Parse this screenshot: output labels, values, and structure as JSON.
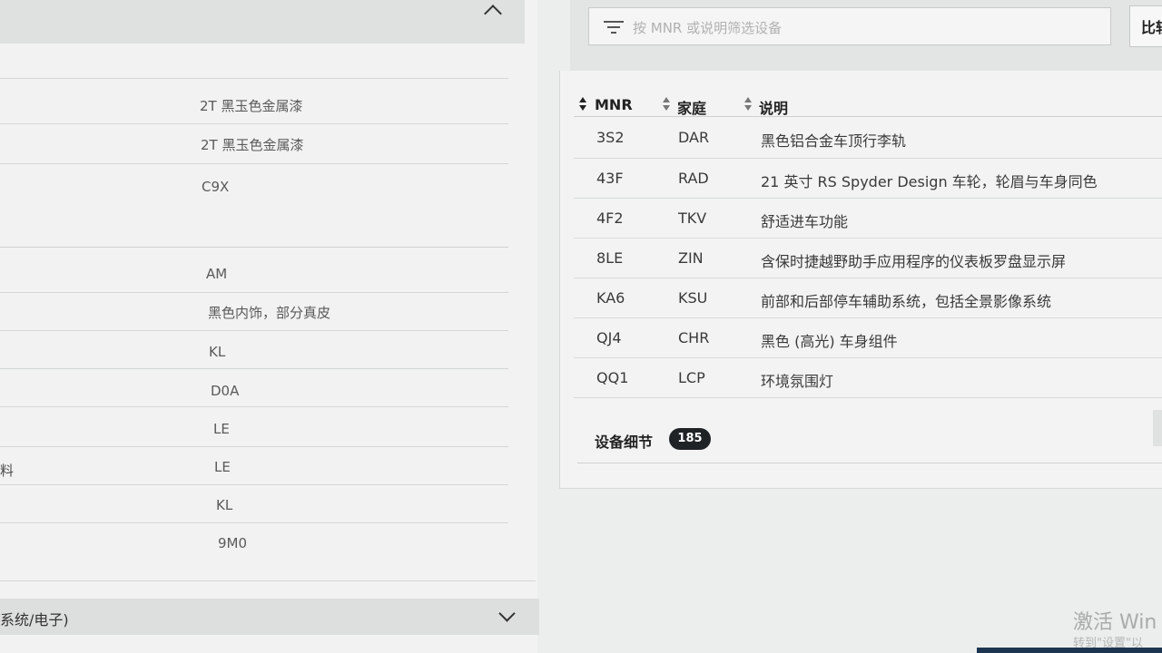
{
  "left_panel": {
    "rows": [
      {
        "label": "",
        "value": "2T 黑玉色金属漆"
      },
      {
        "label": "",
        "value": "2T 黑玉色金属漆"
      },
      {
        "label": "",
        "value": "C9X"
      },
      {
        "label": "",
        "value": "AM"
      },
      {
        "label": "",
        "value": "黑色内饰，部分真皮"
      },
      {
        "label": "",
        "value": "KL"
      },
      {
        "label": "",
        "value": "D0A"
      },
      {
        "label": "",
        "value": "LE"
      },
      {
        "label": "料",
        "value": "LE"
      },
      {
        "label": "",
        "value": "KL"
      },
      {
        "label": "",
        "value": "9M0"
      }
    ],
    "footer_title": "系统/电子)"
  },
  "search": {
    "placeholder": "按 MNR 或说明筛选设备"
  },
  "compare_button": "比较",
  "table": {
    "headers": [
      "MNR",
      "家庭",
      "说明"
    ],
    "rows": [
      {
        "mnr": "3S2",
        "family": "DAR",
        "desc": "黑色铝合金车顶行李轨"
      },
      {
        "mnr": "43F",
        "family": "RAD",
        "desc": "21 英寸 RS Spyder Design 车轮，轮眉与车身同色"
      },
      {
        "mnr": "4F2",
        "family": "TKV",
        "desc": "舒适进车功能"
      },
      {
        "mnr": "8LE",
        "family": "ZIN",
        "desc": "含保时捷越野助手应用程序的仪表板罗盘显示屏"
      },
      {
        "mnr": "KA6",
        "family": "KSU",
        "desc": "前部和后部停车辅助系统，包括全景影像系统"
      },
      {
        "mnr": "QJ4",
        "family": "CHR",
        "desc": "黑色 (高光) 车身组件"
      },
      {
        "mnr": "QQ1",
        "family": "LCP",
        "desc": "环境氛围灯"
      }
    ]
  },
  "details": {
    "label": "设备细节",
    "count": "185"
  },
  "windows_watermark": {
    "line1": "激活 Win",
    "line2": "转到\"设置\"以"
  }
}
